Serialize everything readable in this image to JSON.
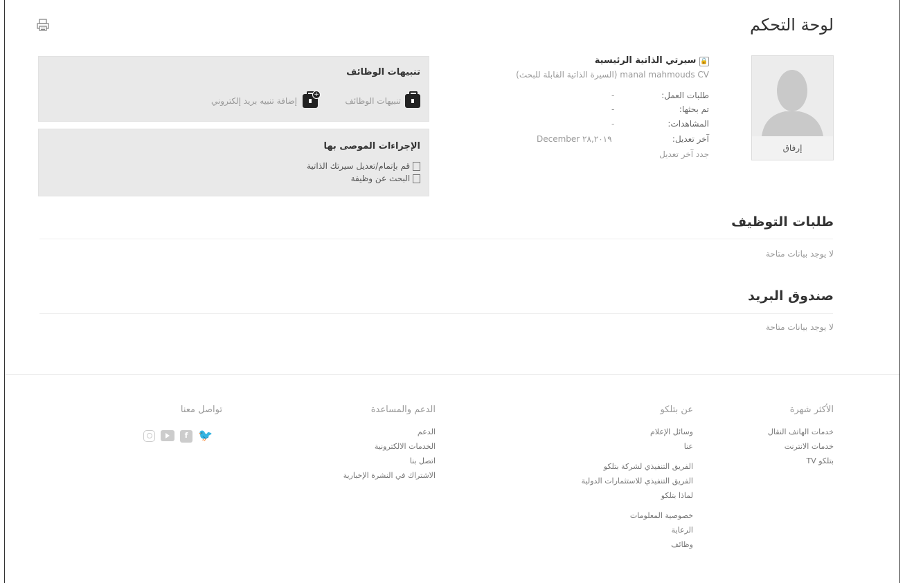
{
  "page": {
    "title": "لوحة التحكم"
  },
  "profile": {
    "upload_label": "إرفاق"
  },
  "cv": {
    "title": "سيرتي الذاتية الرئيسية",
    "subtitle": "manal mahmouds CV (السيرة الذاتية القابلة للبحث)",
    "rows": [
      {
        "label": "طلبات العمل:",
        "value": "-"
      },
      {
        "label": "تم بحثها:",
        "value": "-"
      },
      {
        "label": "المشاهدات:",
        "value": "-"
      },
      {
        "label": "آخر تعديل:",
        "value": "December ٢٨,٢٠١٩"
      }
    ],
    "renew_link": "جدد آخر تعديل"
  },
  "job_alerts": {
    "title": "تنبيهات الوظائف",
    "items": [
      {
        "label": "تنبيهات الوظائف",
        "icon": "briefcase-icon"
      },
      {
        "label": "إضافة تنبيه بريد إلكتروني",
        "icon": "add-alert-icon"
      }
    ]
  },
  "recommended": {
    "title": "الإجراءات الموصى بها",
    "items": [
      {
        "label": "قم بإتمام/تعديل سيرتك الذاتية",
        "icon": "document-icon"
      },
      {
        "label": "البحث عن وظيفة",
        "icon": "search-document-icon"
      }
    ]
  },
  "applications": {
    "title": "طلبات التوظيف",
    "empty": "لا يوجد بيانات متاحة"
  },
  "mailbox": {
    "title": "صندوق البريد",
    "empty": "لا يوجد بيانات متاحة"
  },
  "footer": {
    "popular": {
      "title": "الأكثر شهرة",
      "links": [
        "خدمات الهاتف النقال",
        "خدمات الانترنت",
        "بتلكو TV"
      ]
    },
    "about": {
      "title": "عن بتلكو",
      "links": [
        "وسائل الإعلام",
        "عنا",
        "الفريق التنفيذي لشركة بتلكو",
        "الفريق التنفيذي للاستثمارات الدولية",
        "لماذا بتلكو",
        "خصوصية المعلومات",
        "الرعاية",
        "وظائف"
      ]
    },
    "support": {
      "title": "الدعم والمساعدة",
      "links": [
        "الدعم",
        "الخدمات الالكترونية",
        "اتصل بنا",
        "الاشتراك في النشرة الإخبارية"
      ]
    },
    "contact": {
      "title": "تواصل معنا",
      "social": [
        "twitter-icon",
        "facebook-icon",
        "youtube-icon",
        "instagram-icon"
      ]
    }
  }
}
